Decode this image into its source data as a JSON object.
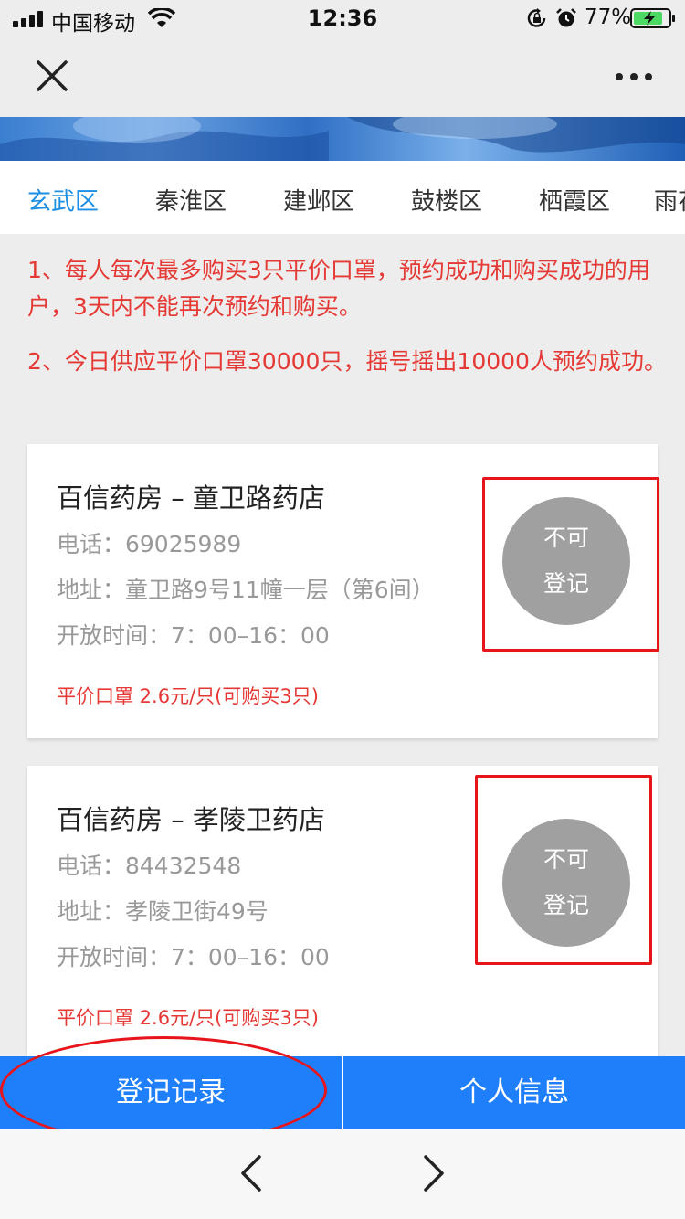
{
  "status_bar": {
    "carrier": "中国移动",
    "time": "12:36",
    "battery": "77%"
  },
  "tabs": [
    "玄武区",
    "秦淮区",
    "建邺区",
    "鼓楼区",
    "栖霞区",
    "雨花"
  ],
  "active_tab": 0,
  "notices": [
    "1、每人每次最多购买3只平价口罩，预约成功和购买成功的用户，3天内不能再次预约和购买。",
    "2、今日供应平价口罩30000只，摇号摇出10000人预约成功。"
  ],
  "stores": [
    {
      "name": "百信药房 – 童卫路药店",
      "phone": "电话：69025989",
      "address": "地址：童卫路9号11幢一层（第6间）",
      "hours": "开放时间：7：00–16：00",
      "price": "平价口罩 2.6元/只(可购买3只)",
      "status_line1": "不可",
      "status_line2": "登记"
    },
    {
      "name": "百信药房 – 孝陵卫药店",
      "phone": "电话：84432548",
      "address": "地址：孝陵卫街49号",
      "hours": "开放时间：7：00–16：00",
      "price": "平价口罩 2.6元/只(可购买3只)",
      "status_line1": "不可",
      "status_line2": "登记"
    }
  ],
  "bottom": {
    "records": "登记记录",
    "profile": "个人信息"
  },
  "colors": {
    "accent": "#1f7ffb",
    "tab_active": "#1a8fe3",
    "notice": "#e53935",
    "disabled": "#a0a0a0",
    "highlight": "#e8141b"
  },
  "icons": [
    "signal-icon",
    "wifi-icon",
    "orientation-lock-icon",
    "alarm-icon",
    "battery-icon",
    "close-icon",
    "more-icon",
    "back-icon",
    "forward-icon"
  ]
}
